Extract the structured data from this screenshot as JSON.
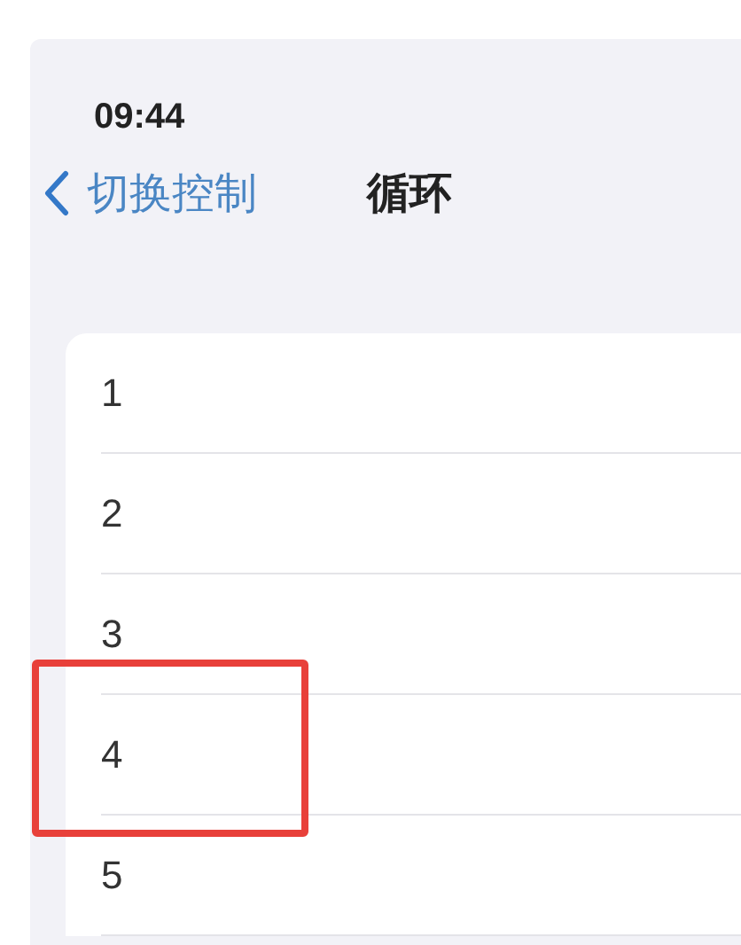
{
  "status_bar": {
    "time": "09:44"
  },
  "nav": {
    "back_label": "切换控制",
    "title": "循环"
  },
  "rows": [
    {
      "label": "1",
      "highlighted": false
    },
    {
      "label": "2",
      "highlighted": false
    },
    {
      "label": "3",
      "highlighted": false
    },
    {
      "label": "4",
      "highlighted": true
    },
    {
      "label": "5",
      "highlighted": false
    }
  ]
}
